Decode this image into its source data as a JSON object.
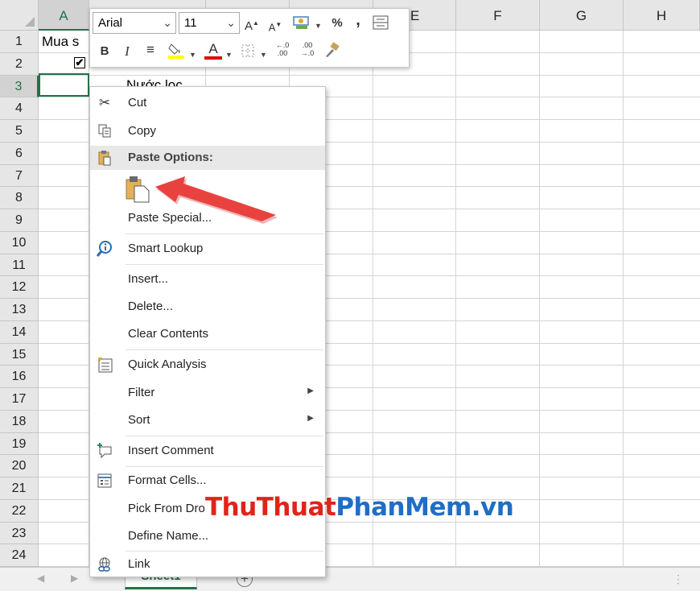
{
  "font_toolbar": {
    "font_name": "Arial",
    "font_size": "11",
    "increase_font_label": "A",
    "decrease_font_label": "A",
    "percent_label": "%",
    "comma_label": ",",
    "bold_label": "B",
    "italic_label": "I",
    "font_color_label": "A",
    "increase_decimal_label": "←.0\n.00",
    "decrease_decimal_label": ".00\n→.0"
  },
  "columns": [
    "A",
    "E",
    "F",
    "G",
    "H"
  ],
  "selected_column": "A",
  "rows": [
    "1",
    "2",
    "3",
    "4",
    "5",
    "6",
    "7",
    "8",
    "9",
    "10",
    "11",
    "12",
    "13",
    "14",
    "15",
    "16",
    "17",
    "18",
    "19",
    "20",
    "21",
    "22",
    "23",
    "24"
  ],
  "selected_row": "3",
  "cells": {
    "a1": "Mua s",
    "a2_checkbox": "✔",
    "b2": "...",
    "b3": "Nước lọc"
  },
  "context_menu": {
    "cut": "Cut",
    "copy": "Copy",
    "paste_options": "Paste Options:",
    "paste_special": "Paste Special...",
    "smart_lookup": "Smart Lookup",
    "insert": "Insert...",
    "delete": "Delete...",
    "clear_contents": "Clear Contents",
    "quick_analysis": "Quick Analysis",
    "filter": "Filter",
    "sort": "Sort",
    "insert_comment": "Insert Comment",
    "format_cells": "Format Cells...",
    "pick_from_dropdown": "Pick From Dro",
    "define_name": "Define Name...",
    "link": "Link"
  },
  "sheet_tabs": {
    "active": "Sheet1",
    "add": "+"
  },
  "watermark": {
    "part1": "ThuThuat",
    "part2": "PhanMem",
    "part3": ".vn"
  },
  "colors": {
    "excel_green": "#217346",
    "arrow_red": "#e8423f",
    "watermark_red": "#e2231a",
    "watermark_blue": "#1f6ec6"
  },
  "icons": {
    "cut": "scissors-icon",
    "copy": "copy-icon",
    "paste_options": "paste-options-icon",
    "paste": "paste-icon",
    "smart_lookup": "smart-lookup-icon",
    "quick_analysis": "quick-analysis-icon",
    "insert_comment": "insert-comment-icon",
    "format_cells": "format-cells-icon",
    "link": "link-icon"
  }
}
